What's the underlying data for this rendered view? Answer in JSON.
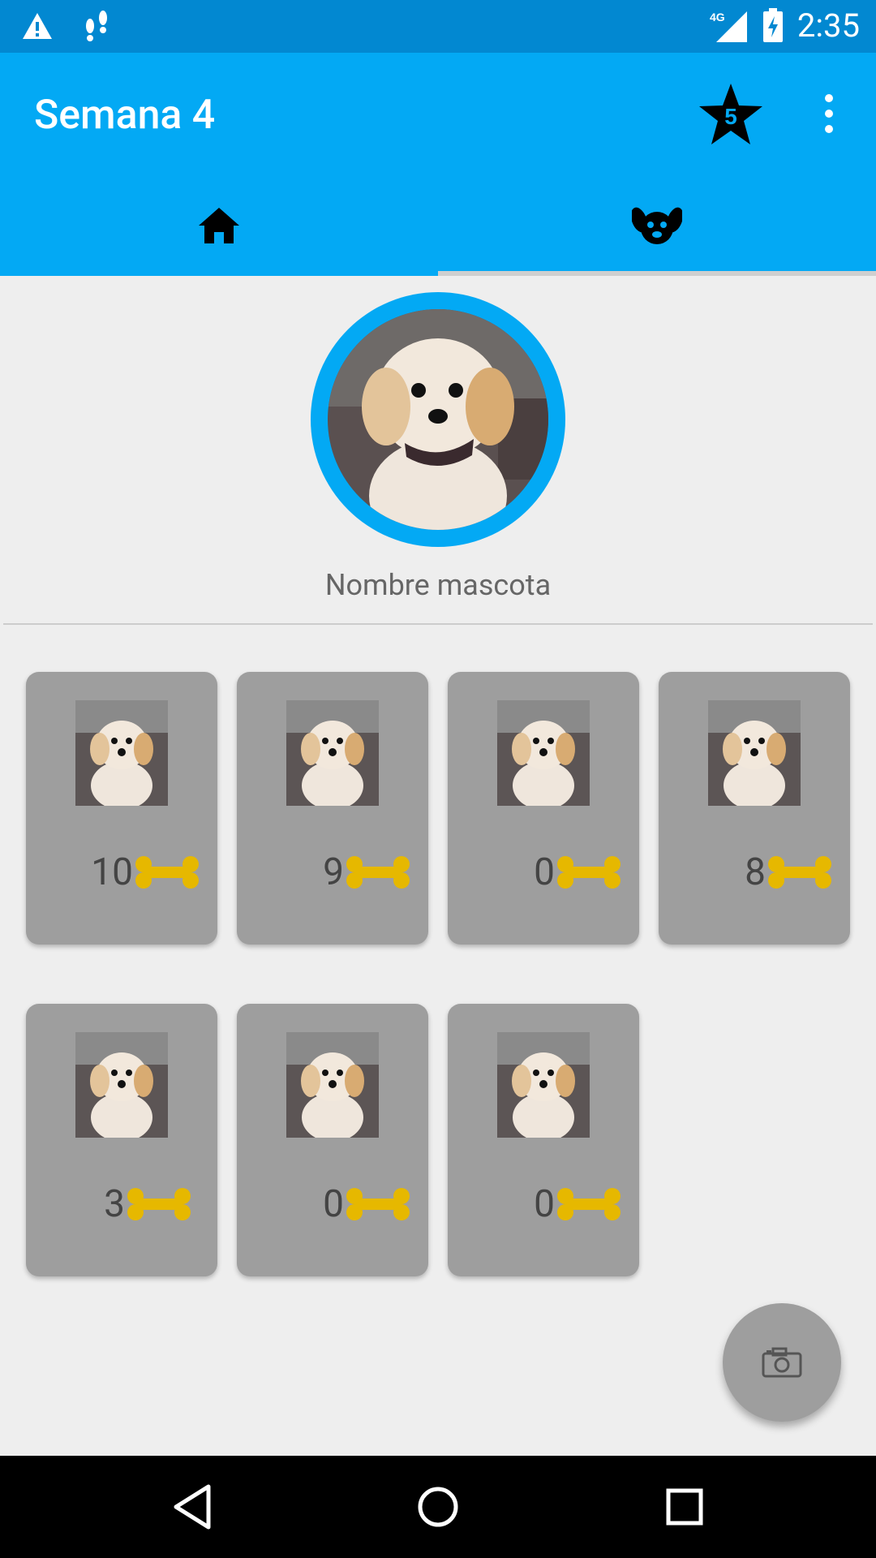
{
  "status_bar": {
    "time": "2:35",
    "network": "4G"
  },
  "app_bar": {
    "title": "Semana 4",
    "favorites_badge": "5"
  },
  "tabs": [
    {
      "name": "home",
      "icon": "home-icon",
      "selected": false
    },
    {
      "name": "pet",
      "icon": "dog-icon",
      "selected": true
    }
  ],
  "profile": {
    "pet_name": "Nombre mascota"
  },
  "photos": [
    {
      "likes": "10"
    },
    {
      "likes": "9"
    },
    {
      "likes": "0"
    },
    {
      "likes": "8"
    },
    {
      "likes": "3"
    },
    {
      "likes": "0"
    },
    {
      "likes": "0"
    }
  ],
  "colors": {
    "primary": "#03a9f4",
    "primary_dark": "#0288d1",
    "bone": "#e6b800",
    "card": "#9e9e9e"
  }
}
